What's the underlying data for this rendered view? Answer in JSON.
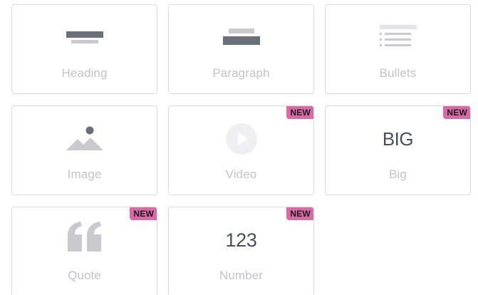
{
  "blocks": [
    {
      "label": "Heading",
      "icon": "heading-icon"
    },
    {
      "label": "Paragraph",
      "icon": "paragraph-icon"
    },
    {
      "label": "Bullets",
      "icon": "bullets-icon"
    },
    {
      "label": "Image",
      "icon": "image-icon"
    },
    {
      "label": "Video",
      "icon": "video-icon",
      "badge": "NEW"
    },
    {
      "label": "Big",
      "icon": "big-icon",
      "icon_text": "BIG",
      "badge": "NEW"
    },
    {
      "label": "Quote",
      "icon": "quote-icon",
      "badge": "NEW"
    },
    {
      "label": "Number",
      "icon": "number-icon",
      "icon_text": "123",
      "badge": "NEW"
    }
  ],
  "colors": {
    "badge": "#d86aa6",
    "icon_dark": "#6b6f7a",
    "icon_light": "#c9c9ce",
    "label": "#c3c3c8",
    "border": "#dcdcdf"
  }
}
